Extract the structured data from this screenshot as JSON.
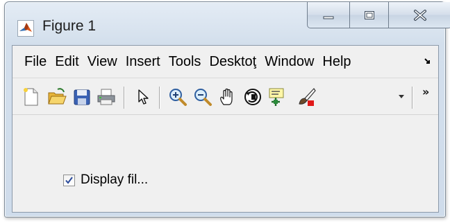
{
  "window": {
    "title": "Figure 1"
  },
  "menu": {
    "items": [
      "File",
      "Edit",
      "View",
      "Insert",
      "Tools",
      "Desktoţ",
      "Window",
      "Help"
    ]
  },
  "toolbar": {
    "buttons": [
      {
        "icon": "new-figure-icon"
      },
      {
        "icon": "open-file-icon"
      },
      {
        "icon": "save-figure-icon"
      },
      {
        "icon": "print-figure-icon"
      },
      {
        "icon": "edit-plot-cursor-icon"
      },
      {
        "icon": "zoom-in-icon"
      },
      {
        "icon": "zoom-out-icon"
      },
      {
        "icon": "pan-hand-icon"
      },
      {
        "icon": "rotate-3d-icon"
      },
      {
        "icon": "data-cursor-icon"
      },
      {
        "icon": "brush-icon"
      }
    ],
    "overflow_label": "»"
  },
  "checkbox": {
    "label": "Display fil...",
    "checked": true
  },
  "colors": {
    "title_gradient_top": "#e4ecf5",
    "client_background": "#f0f0f0",
    "checkbox_mark": "#2a4a9a",
    "brush_red": "#e01818"
  }
}
